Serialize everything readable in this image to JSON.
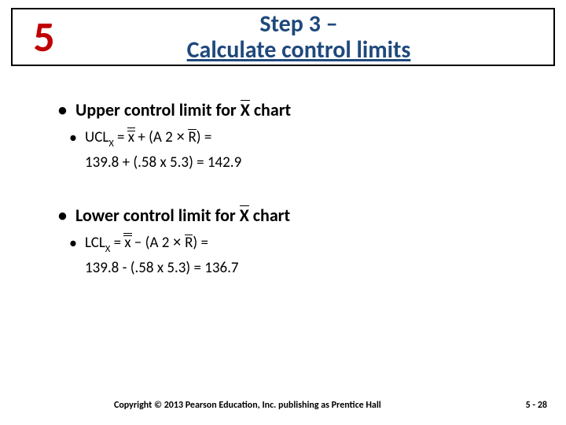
{
  "chapter": "5",
  "title_line1": "Step 3 –",
  "title_line2": "Calculate control limits",
  "upper": {
    "heading_prefix": "Upper control limit for ",
    "heading_chart": "X",
    "heading_suffix": " chart",
    "formula_label": "UCL",
    "formula_sub": "X",
    "eq": " = ",
    "xbar": "x",
    "op": " + (A 2  ",
    "times": "×",
    "space": " ",
    "rbar": "R",
    "close": ") =",
    "calc": "139.8 + (.58 x 5.3) = 142.9"
  },
  "lower": {
    "heading_prefix": "Lower control limit for ",
    "heading_chart": "X",
    "heading_suffix": " chart",
    "formula_label": "LCL",
    "formula_sub": "X",
    "eq": " = ",
    "xbar": "x",
    "op": " − (A 2  ",
    "times": "×",
    "space": " ",
    "rbar": "R",
    "close": ") =",
    "calc": "139.8 - (.58 x 5.3) = 136.7"
  },
  "footer": {
    "copyright": "Copyright © 2013 Pearson Education, Inc. publishing as Prentice Hall",
    "page": "5 - 28"
  }
}
